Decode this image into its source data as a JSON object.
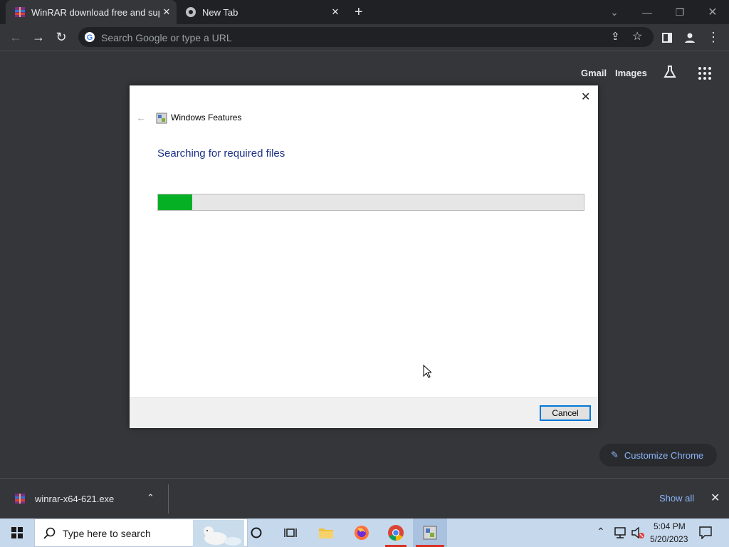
{
  "browser": {
    "tabs": [
      {
        "label": "WinRAR download free and supp"
      },
      {
        "label": "New Tab"
      }
    ],
    "omnibox_placeholder": "Search Google or type a URL"
  },
  "ntp": {
    "gmail": "Gmail",
    "images": "Images",
    "customize": "Customize Chrome"
  },
  "dialog": {
    "title": "Windows Features",
    "heading": "Searching for required files",
    "progress": 0.08,
    "cancel_label": "Cancel"
  },
  "downloads": {
    "file": "winrar-x64-621.exe",
    "show_all": "Show all"
  },
  "taskbar": {
    "search_placeholder": "Type here to search",
    "time": "5:04 PM",
    "date": "5/20/2023"
  },
  "colors": {
    "progress_fill": "#06b025",
    "dialog_heading": "#1e3287",
    "link_blue": "#8ab4f8"
  }
}
